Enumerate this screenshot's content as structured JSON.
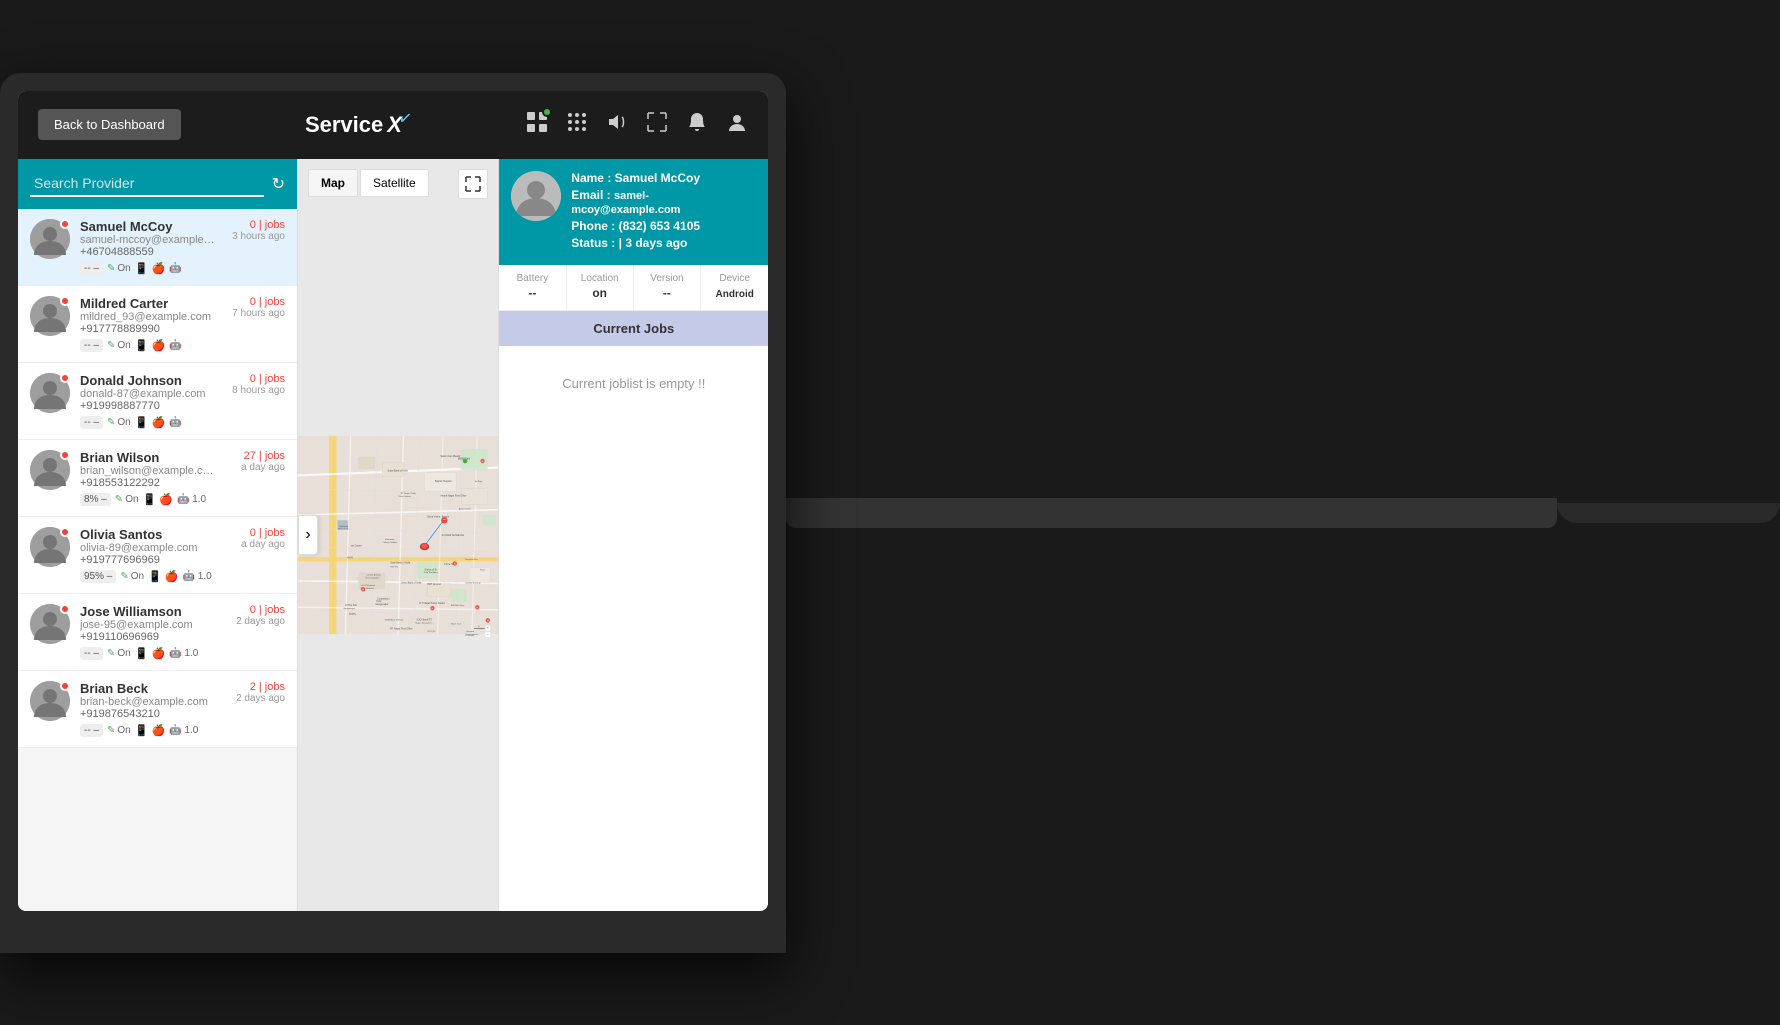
{
  "topbar": {
    "back_button": "Back to Dashboard",
    "logo_text": "Service",
    "logo_suffix": "X✓"
  },
  "search": {
    "placeholder": "Search Provider",
    "label": "Search Provider"
  },
  "providers": [
    {
      "name": "Samuel McCoy",
      "email": "samuel-mccoy@example.com",
      "phone": "+46704888559",
      "jobs": "0 | jobs",
      "time": "3 hours ago",
      "battery": "--",
      "status": "On",
      "active": true
    },
    {
      "name": "Mildred Carter",
      "email": "mildred_93@example.com",
      "phone": "+917778889990",
      "jobs": "0 | jobs",
      "time": "7 hours ago",
      "battery": "--",
      "status": "On",
      "active": false
    },
    {
      "name": "Donald Johnson",
      "email": "donald-87@example.com",
      "phone": "+919998887770",
      "jobs": "0 | jobs",
      "time": "8 hours ago",
      "battery": "--",
      "status": "On",
      "active": false
    },
    {
      "name": "Brian Wilson",
      "email": "brian_wilson@example.com",
      "phone": "+918553122292",
      "jobs": "27 | jobs",
      "time": "a day ago",
      "battery": "8%",
      "status": "On",
      "active": false
    },
    {
      "name": "Olivia Santos",
      "email": "olivia-89@example.com",
      "phone": "+919777696969",
      "jobs": "0 | jobs",
      "time": "a day ago",
      "battery": "95%",
      "status": "On",
      "active": false
    },
    {
      "name": "Jose Williamson",
      "email": "jose-95@example.com",
      "phone": "+919110696969",
      "jobs": "0 | jobs",
      "time": "2 days ago",
      "battery": "--",
      "status": "On",
      "active": false
    },
    {
      "name": "Brian Beck",
      "email": "brian-beck@example.com",
      "phone": "+919876543210",
      "jobs": "2 | jobs",
      "time": "2 days ago",
      "battery": "--",
      "status": "On",
      "active": false
    }
  ],
  "map": {
    "tab_map": "Map",
    "tab_satellite": "Satellite"
  },
  "user_panel": {
    "name_label": "Name :",
    "name": "Samuel McCoy",
    "email_label": "Email :",
    "email": "samel-mcoy@example.com",
    "phone_label": "Phone :",
    "phone": "(832) 653 4105",
    "status_label": "Status :",
    "status": "| 3 days ago",
    "battery_label": "Battery",
    "battery_value": "--",
    "location_label": "Location",
    "location_value": "on",
    "version_label": "Version",
    "version_value": "--",
    "device_label": "Device",
    "device_value": "Android",
    "current_jobs_header": "Current Jobs",
    "current_jobs_empty": "Current joblist is empty !!"
  }
}
